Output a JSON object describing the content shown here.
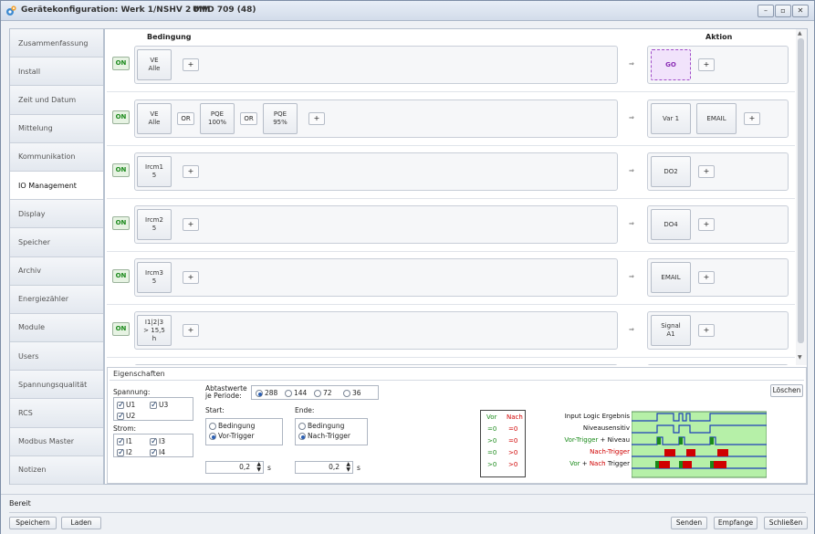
{
  "window": {
    "title": "Gerätekonfiguration: Werk 1/NSHV 2 MM",
    "subtitle": "UMD 709 (48)",
    "controls": [
      "–",
      "▫",
      "✕"
    ]
  },
  "sidebar": {
    "items": [
      "Zusammenfassung",
      "Install",
      "Zeit und Datum",
      "Mittelung",
      "Kommunikation",
      "IO Management",
      "Display",
      "Speicher",
      "Archiv",
      "Energiezähler",
      "Module",
      "Users",
      "Spannungsqualität",
      "RCS",
      "Modbus Master",
      "Notizen"
    ],
    "active_index": 5
  },
  "rules": {
    "header_condition": "Bedingung",
    "header_action": "Aktion",
    "on_label": "ON",
    "plus_label": "+",
    "or_label": "OR",
    "arrow_label": "⇒",
    "rows": [
      {
        "conditions": [
          "VE\nAlle"
        ],
        "actions": [
          "GO"
        ]
      },
      {
        "conditions": [
          "VE\nAlle",
          "PQE\n100%",
          "PQE\n95%"
        ],
        "actions": [
          "Var 1",
          "EMAIL"
        ]
      },
      {
        "conditions": [
          "Ircm1\n5"
        ],
        "actions": [
          "DO2"
        ]
      },
      {
        "conditions": [
          "Ircm2\n5"
        ],
        "actions": [
          "DO4"
        ]
      },
      {
        "conditions": [
          "Ircm3\n5"
        ],
        "actions": [
          "EMAIL"
        ]
      },
      {
        "conditions": [
          "I1|2|3\n> 15,5\nh"
        ],
        "actions": [
          "Signal\nA1"
        ]
      }
    ]
  },
  "properties": {
    "title": "Eigenschaften",
    "spannung_label": "Spannung:",
    "spannung": [
      {
        "label": "U1",
        "checked": true
      },
      {
        "label": "U3",
        "checked": true
      },
      {
        "label": "U2",
        "checked": true
      }
    ],
    "strom_label": "Strom:",
    "strom": [
      {
        "label": "I1",
        "checked": true
      },
      {
        "label": "I3",
        "checked": true
      },
      {
        "label": "I2",
        "checked": true
      },
      {
        "label": "I4",
        "checked": true
      }
    ],
    "abtast_label_1": "Abtastwerte",
    "abtast_label_2": "je Periode:",
    "abtast_options": [
      {
        "label": "288",
        "selected": true
      },
      {
        "label": "144",
        "selected": false
      },
      {
        "label": "72",
        "selected": false
      },
      {
        "label": "36",
        "selected": false
      }
    ],
    "start_label": "Start:",
    "ende_label": "Ende:",
    "start_options": [
      {
        "label": "Bedingung",
        "selected": false
      },
      {
        "label": "Vor-Trigger",
        "selected": true
      }
    ],
    "ende_options": [
      {
        "label": "Bedingung",
        "selected": false
      },
      {
        "label": "Nach-Trigger",
        "selected": true
      }
    ],
    "start_value": "0,2",
    "ende_value": "0,2",
    "unit": "s",
    "loeschen": "Löschen",
    "trigger_table": {
      "header_vor": "Vor",
      "header_nach": "Nach",
      "rows": [
        [
          "=0",
          "=0"
        ],
        [
          ">0",
          "=0"
        ],
        [
          "=0",
          ">0"
        ],
        [
          ">0",
          ">0"
        ]
      ]
    },
    "trigger_labels": {
      "l1": "Input Logic Ergebnis",
      "l2": "Niveausensitiv",
      "l3a": "Vor-Trigger",
      "l3b": " + Niveau",
      "l4": "Nach-Trigger",
      "l5a": "Vor",
      "l5b": " + ",
      "l5c": "Nach",
      "l5d": " Trigger"
    },
    "colors": {
      "vor": "#1a8a1a",
      "nach": "#d00000",
      "diag_bg": "#b6f0a8",
      "diag_line": "#1d3fb8"
    }
  },
  "status": {
    "text": "Bereit",
    "buttons_left": [
      "Speichern",
      "Laden"
    ],
    "buttons_right": [
      "Senden",
      "Empfange",
      "Schließen"
    ]
  }
}
